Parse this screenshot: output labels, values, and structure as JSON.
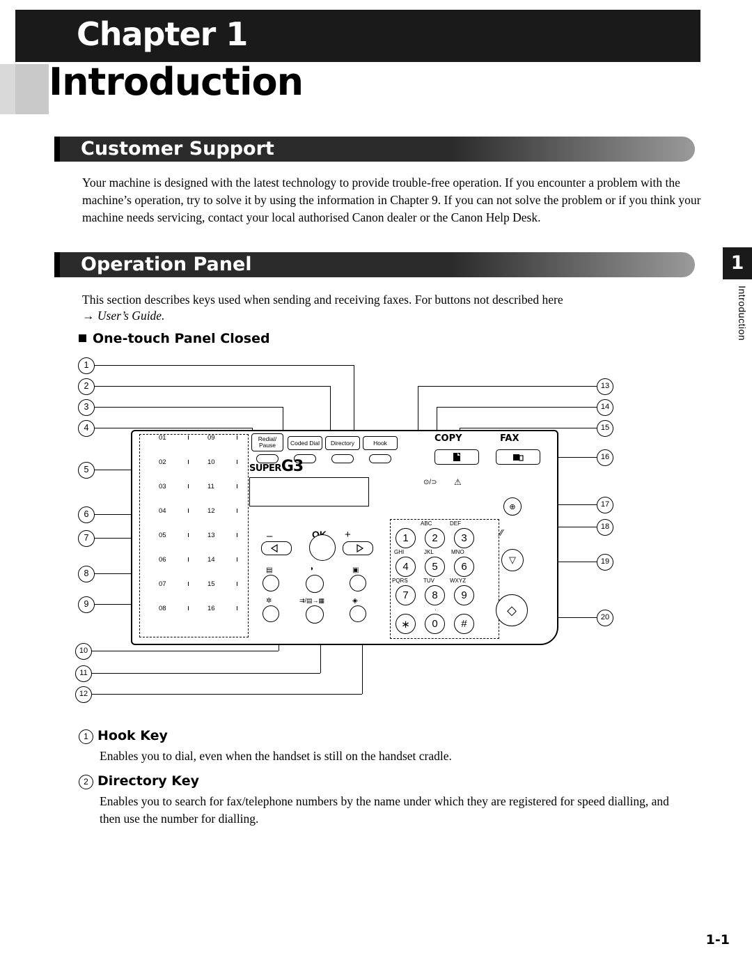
{
  "header": {
    "chapter_label": "Chapter  1",
    "title": "Introduction"
  },
  "sections": [
    {
      "id": "customer-support",
      "heading": "Customer Support",
      "body": "Your machine is designed with the latest technology to provide trouble-free operation. If you encounter a problem with the machine’s operation, try to solve it by using the information in Chapter 9. If you can not solve the problem or if you think your machine needs servicing, contact your local authorised Canon dealer or the Canon Help Desk."
    },
    {
      "id": "operation-panel",
      "heading": "Operation Panel",
      "body": "This section describes keys used when sending and receiving faxes. For buttons not described here",
      "cross_reference": "→ User’s Guide."
    }
  ],
  "subheading": "One-touch Panel Closed",
  "side_tab": {
    "number": "1",
    "label": "Introduction"
  },
  "page_number": "1-1",
  "figure": {
    "callouts": [
      "1",
      "2",
      "3",
      "4",
      "5",
      "6",
      "7",
      "8",
      "9",
      "10",
      "11",
      "12",
      "13",
      "14",
      "15",
      "16",
      "17",
      "18",
      "19",
      "20"
    ],
    "one_touch_numbers_left": [
      "01",
      "02",
      "03",
      "04",
      "05",
      "06",
      "07",
      "08"
    ],
    "one_touch_numbers_right": [
      "09",
      "10",
      "11",
      "12",
      "13",
      "14",
      "15",
      "16"
    ],
    "function_buttons": [
      {
        "name": "redial-pause",
        "line1": "Redial/",
        "line2": "Pause"
      },
      {
        "name": "coded-dial",
        "line1": "Coded Dial",
        "line2": ""
      },
      {
        "name": "directory",
        "line1": "Directory",
        "line2": ""
      },
      {
        "name": "hook",
        "line1": "Hook",
        "line2": ""
      }
    ],
    "lcd_brand": {
      "super": "SUPER",
      "g3": "G3"
    },
    "nav": {
      "minus": "–",
      "ok": "OK",
      "plus": "+"
    },
    "copy_label": "COPY",
    "fax_label": "FAX",
    "keypad": [
      {
        "digit": "1",
        "letters": ""
      },
      {
        "digit": "2",
        "letters": "ABC"
      },
      {
        "digit": "3",
        "letters": "DEF"
      },
      {
        "digit": "4",
        "letters": "GHI"
      },
      {
        "digit": "5",
        "letters": "JKL"
      },
      {
        "digit": "6",
        "letters": "MNO"
      },
      {
        "digit": "7",
        "letters": "PQRS"
      },
      {
        "digit": "8",
        "letters": "TUV"
      },
      {
        "digit": "9",
        "letters": "WXYZ"
      },
      {
        "digit": "∗",
        "letters": ""
      },
      {
        "digit": "0",
        "letters": ""
      },
      {
        "digit": "#",
        "letters": ""
      }
    ]
  },
  "items": [
    {
      "num": "1",
      "title": "Hook  Key",
      "body": "Enables you to dial, even when the handset is still on the handset cradle."
    },
    {
      "num": "2",
      "title": "Directory Key",
      "body": "Enables you to search for fax/telephone numbers by the name under which they are registered for speed dialling, and then use the number for dialling."
    }
  ]
}
